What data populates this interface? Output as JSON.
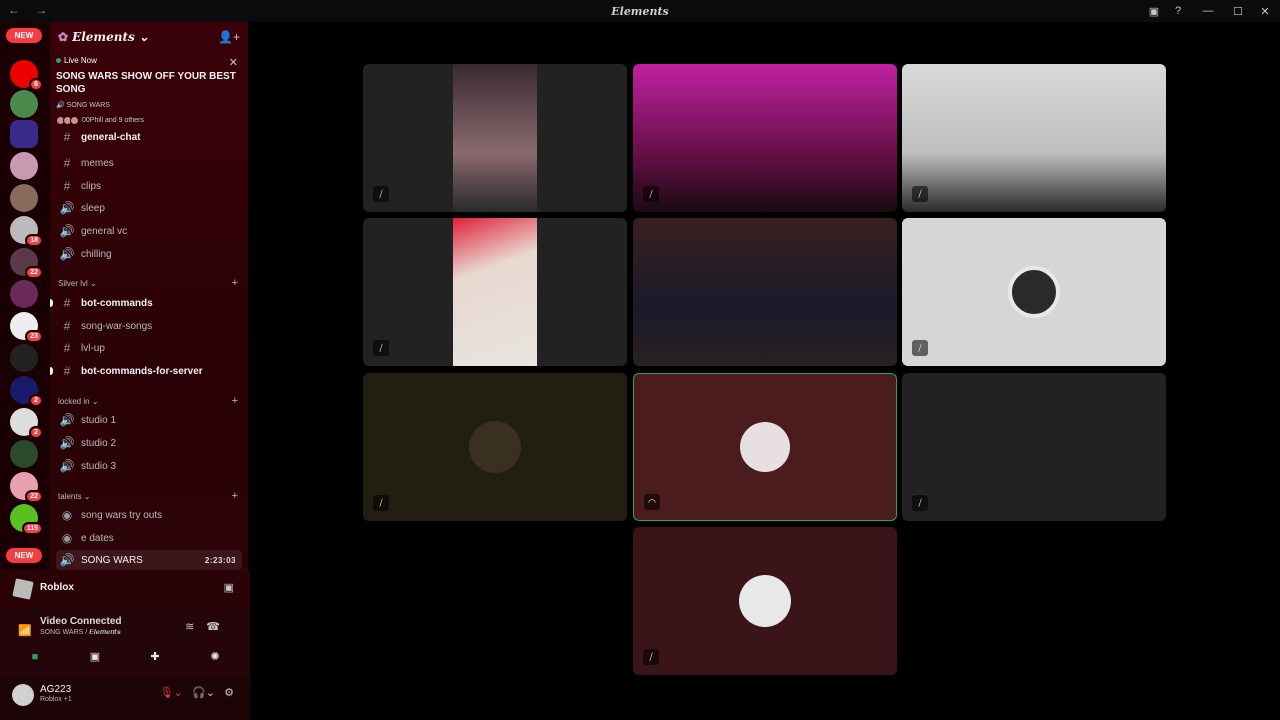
{
  "titlebar": {
    "nav": "← →",
    "title": "𝑬𝒍𝒆𝒎𝒆𝒏𝒕𝒔",
    "icons": [
      "screen-share-icon",
      "help-icon",
      "minimize-icon",
      "maximize-icon",
      "close-icon"
    ],
    "glyphs": [
      "▣",
      "?",
      "—",
      "☐",
      "✕"
    ]
  },
  "servers": {
    "new_label": "NEW",
    "badges": [
      "6",
      "18",
      "22",
      "23",
      "2",
      "2",
      "22",
      "115"
    ]
  },
  "sidebar": {
    "server_name": "𝑬𝒍𝒆𝒎𝒆𝒏𝒕𝒔",
    "live": {
      "tag": "Live Now",
      "title": "SONG WARS SHOW OFF YOUR BEST SONG",
      "channel": "SONG WARS",
      "people": "00Phill and 9 others"
    },
    "channels_top": [
      {
        "sym": "#",
        "name": "general-chat"
      },
      {
        "sym": "#",
        "name": "memes"
      },
      {
        "sym": "#",
        "name": "clips"
      },
      {
        "sym": "🔊",
        "name": "sleep"
      },
      {
        "sym": "🔊",
        "name": "general vc"
      },
      {
        "sym": "🔊",
        "name": "chilling"
      }
    ],
    "category_silver": "Silver lvl ⌄",
    "channels_silver": [
      {
        "sym": "#",
        "name": "bot-commands"
      },
      {
        "sym": "#",
        "name": "song-war-songs"
      },
      {
        "sym": "#",
        "name": "lvl-up"
      },
      {
        "sym": "#",
        "name": "bot-commands-for-server"
      }
    ],
    "category_locked": "locked in ⌄",
    "channels_locked": [
      {
        "sym": "🔊",
        "name": "studio 1"
      },
      {
        "sym": "🔊",
        "name": "studio 2"
      },
      {
        "sym": "🔊",
        "name": "studio 3"
      }
    ],
    "category_talents": "talents ⌄",
    "channels_talents": [
      {
        "sym": "◉",
        "name": "song wars try outs"
      },
      {
        "sym": "◉",
        "name": "e dates"
      },
      {
        "sym": "🔊",
        "name": "SONG WARS",
        "time": "2:23:03"
      }
    ]
  },
  "activity": {
    "game": "Roblox"
  },
  "voice": {
    "status": "Video Connected",
    "location": "SONG WARS / 𝑬𝒍𝒆𝒎𝒆𝒏𝒕𝒔"
  },
  "user": {
    "name": "AG223",
    "status": "Roblox +1"
  },
  "colors": {
    "accent_green": "#23a55a",
    "mute_red": "#f23f43",
    "sidebar_bg": "#3a0208"
  }
}
